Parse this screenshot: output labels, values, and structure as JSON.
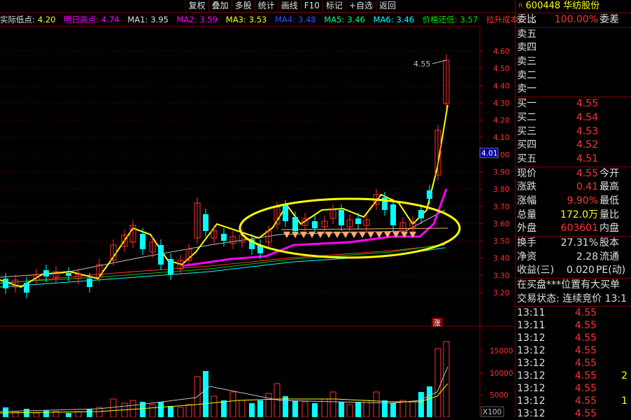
{
  "toolbar": {
    "items": [
      "复权",
      "叠加",
      "多股",
      "统计",
      "画线",
      "F10",
      "标记",
      "+自选",
      "返回"
    ]
  },
  "legend": {
    "low_label": "实际低点:",
    "low_value": "4.20",
    "high_label": "明日高点:",
    "high_value": "4.74",
    "ma1_label": "MA1:",
    "ma1_value": "3.95",
    "ma2_label": "MA2:",
    "ma2_value": "3.59",
    "ma3_label": "MA3:",
    "ma3_value": "3.53",
    "ma4_label": "MA4:",
    "ma4_value": "3.48",
    "ma5_label": "MA5:",
    "ma5_value": "3.46",
    "ma6_label": "MA6:",
    "ma6_value": "3.46",
    "price_return_label": "价格还低:",
    "price_return_value": "3.57",
    "pull_cost_label": "拉升成本:",
    "diamond": "◇"
  },
  "price_axis": [
    "4.60",
    "4.50",
    "4.40",
    "4.30",
    "4.20",
    "4.10",
    "4.00",
    "3.90",
    "3.80",
    "3.70",
    "3.60",
    "3.50",
    "3.40",
    "3.30",
    "3.20"
  ],
  "current_price_tag": "4.01",
  "peak_annotation": "4.55",
  "limit_marker": "涨",
  "volume_axis": [
    "15000",
    "10000",
    "5000"
  ],
  "volume_unit": "X100",
  "colors": {
    "up": "#ff3232",
    "down": "#00ffff",
    "ma_yellow": "#ffff00",
    "ma_magenta": "#ff00ff",
    "grid": "#800000"
  },
  "quote": {
    "code": "600448",
    "name": "华纺股份",
    "r_mark": "R",
    "weibi_label": "委比",
    "weibi_value": "100.00%",
    "weicha_label": "委差",
    "sell": [
      {
        "label": "卖五",
        "price": ""
      },
      {
        "label": "卖四",
        "price": ""
      },
      {
        "label": "卖三",
        "price": ""
      },
      {
        "label": "卖二",
        "price": ""
      },
      {
        "label": "卖一",
        "price": ""
      }
    ],
    "buy": [
      {
        "label": "买一",
        "price": "4.55"
      },
      {
        "label": "买二",
        "price": "4.54"
      },
      {
        "label": "买三",
        "price": "4.53"
      },
      {
        "label": "买四",
        "price": "4.52"
      },
      {
        "label": "买五",
        "price": "4.51"
      }
    ],
    "stats": [
      {
        "l1": "现价",
        "v1": "4.55",
        "l2": "今开"
      },
      {
        "l1": "涨跌",
        "v1": "0.41",
        "l2": "最高"
      },
      {
        "l1": "涨幅",
        "v1": "9.90%",
        "l2": "最低"
      },
      {
        "l1": "总量",
        "v1": "172.0万",
        "l2": "量比"
      },
      {
        "l1": "外盘",
        "v1": "603601",
        "l2": "内盘"
      }
    ],
    "stats2": [
      {
        "l1": "换手",
        "v1": "27.31%",
        "l2": "股本"
      },
      {
        "l1": "净资",
        "v1": "2.28",
        "l2": "流通"
      },
      {
        "l1": "收益(三)",
        "v1": "0.020",
        "l2": "PE(动)"
      }
    ],
    "notice": "在买盘***位置有大买单",
    "trade_status": "交易状态: 连续竞价 13:1",
    "ticks": [
      {
        "time": "13:11",
        "price": "4.55",
        "vol": ""
      },
      {
        "time": "13:11",
        "price": "4.55",
        "vol": ""
      },
      {
        "time": "13:12",
        "price": "4.55",
        "vol": ""
      },
      {
        "time": "13:12",
        "price": "4.55",
        "vol": ""
      },
      {
        "time": "13:12",
        "price": "4.55",
        "vol": ""
      },
      {
        "time": "13:12",
        "price": "4.55",
        "vol": "2"
      },
      {
        "time": "13:12",
        "price": "4.55",
        "vol": ""
      },
      {
        "time": "13:12",
        "price": "4.55",
        "vol": "1"
      },
      {
        "time": "13:12",
        "price": "4.55",
        "vol": ""
      }
    ]
  }
}
